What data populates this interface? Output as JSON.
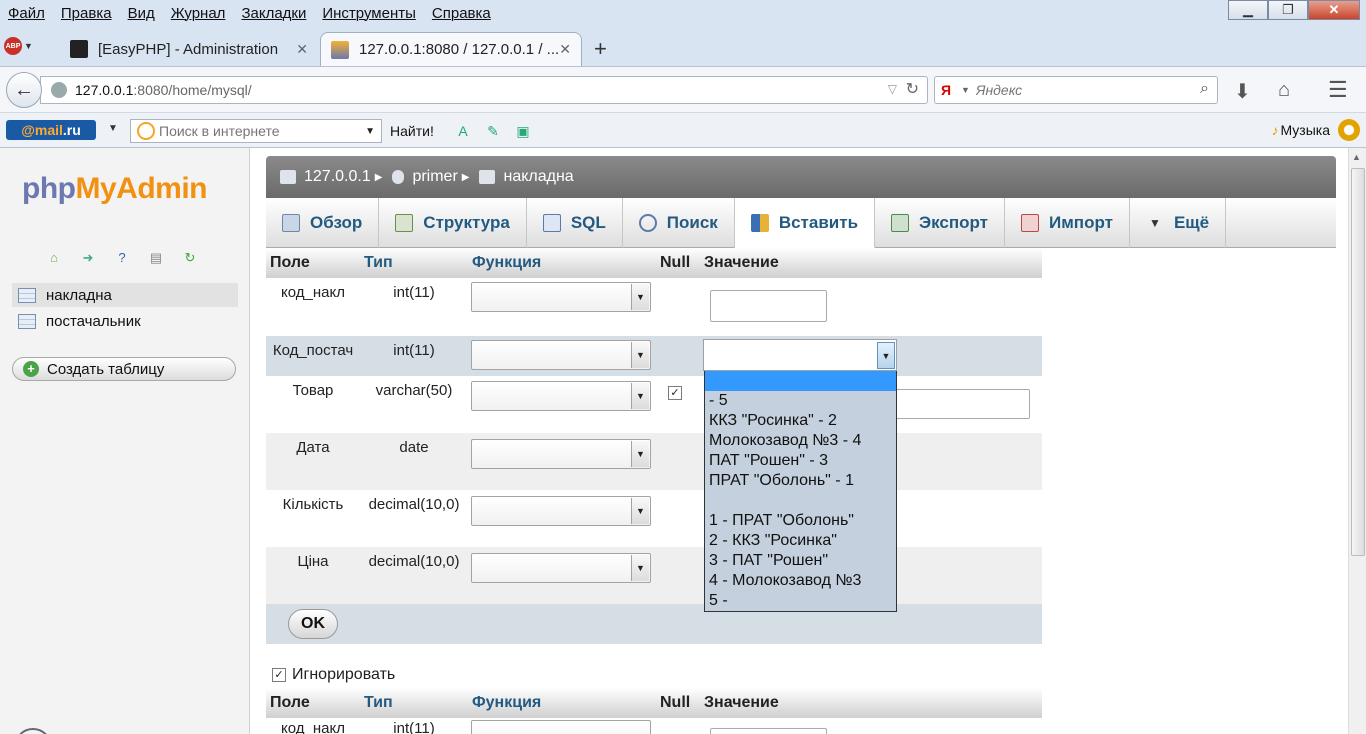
{
  "menubar": {
    "items": [
      "Файл",
      "Правка",
      "Вид",
      "Журнал",
      "Закладки",
      "Инструменты",
      "Справка"
    ]
  },
  "tabs": [
    {
      "label": "[EasyPHP] - Administration"
    },
    {
      "label": "127.0.0.1:8080 / 127.0.0.1 / ..."
    }
  ],
  "address": {
    "host": "127.0.0.1",
    "path": ":8080/home/mysql/"
  },
  "search": {
    "placeholder": "Яндекс"
  },
  "bookmarks": {
    "mailru_a": "@mail",
    "mailru_b": ".ru",
    "search_placeholder": "Поиск в интернете",
    "find_label": "Найти!",
    "music_label": "Музыка"
  },
  "sidebar": {
    "logo_php": "php",
    "logo_mya": "MyAdmin",
    "tables": [
      "накладна",
      "постачальник"
    ],
    "create_label": "Создать таблицу"
  },
  "breadcrumb": {
    "server": "127.0.0.1",
    "db": "primer",
    "table": "накладна"
  },
  "pma_tabs": [
    "Обзор",
    "Структура",
    "SQL",
    "Поиск",
    "Вставить",
    "Экспорт",
    "Импорт",
    "Ещё"
  ],
  "form": {
    "headers": [
      "Поле",
      "Тип",
      "Функция",
      "Null",
      "Значение"
    ],
    "rows": [
      {
        "name": "код_накл",
        "type": "int(11)"
      },
      {
        "name": "Код_постач",
        "type": "int(11)"
      },
      {
        "name": "Товар",
        "type": "varchar(50)"
      },
      {
        "name": "Дата",
        "type": "date"
      },
      {
        "name": "Кількість",
        "type": "decimal(10,0)"
      },
      {
        "name": "Ціна",
        "type": "decimal(10,0)"
      }
    ],
    "ok_label": "OK",
    "ignore_label": "Игнорировать",
    "second_row_name": "код_накл",
    "second_row_type": "int(11)"
  },
  "dropdown_options": [
    "",
    " - 5",
    "ККЗ \"Росинка\" - 2",
    "Молокозавод №3 - 4",
    "ПАТ \"Рошен\" - 3",
    "ПРАТ \"Оболонь\" - 1",
    "",
    "1 - ПРАТ \"Оболонь\"",
    "2 - ККЗ \"Росинка\"",
    "3 - ПАТ \"Рошен\"",
    "4 - Молокозавод №3",
    "5 -"
  ],
  "colors": {
    "accent_blue": "#235a81",
    "highlight": "#3399ff",
    "pma_orange": "#f29111",
    "pma_purple": "#6c78af"
  }
}
